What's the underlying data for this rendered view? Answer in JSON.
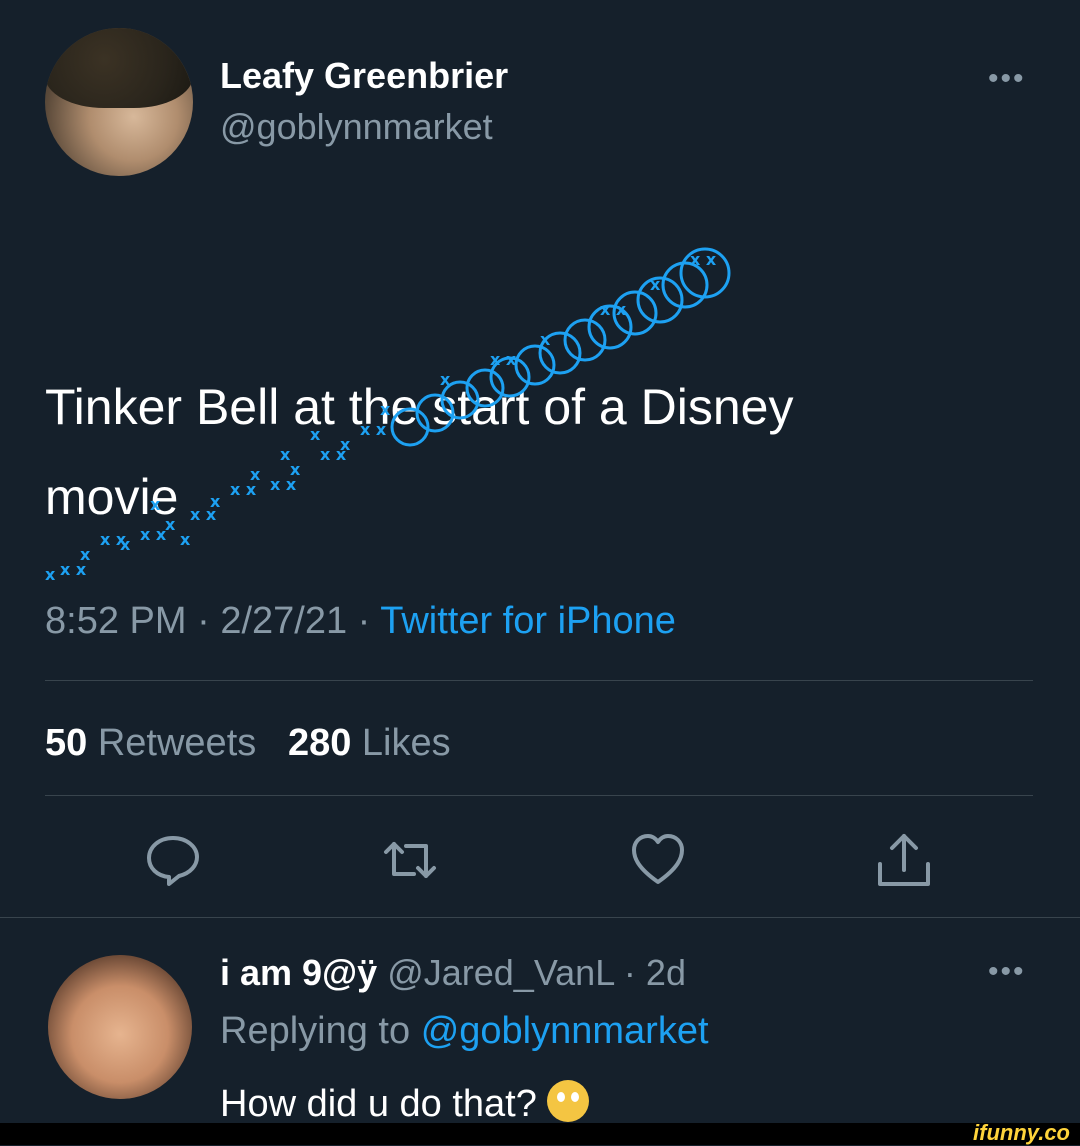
{
  "tweet": {
    "author_name": "Leafy Greenbrier",
    "author_handle": "@goblynnmarket",
    "more_icon": "•••",
    "text_line1": "Tinker Bell at the start of a Disney",
    "text_line2": "movie",
    "time": "8:52 PM",
    "date": "2/27/21",
    "separator": "·",
    "source": "Twitter for iPhone",
    "retweets_count": "50",
    "retweets_label": "Retweets",
    "likes_count": "280",
    "likes_label": "Likes"
  },
  "actions": {
    "icons": [
      "reply-icon",
      "retweet-icon",
      "like-icon",
      "share-icon"
    ]
  },
  "reply": {
    "name": "i am 9@ÿ",
    "handle": "@Jared_VanL",
    "age": "2d",
    "replying_prefix": "Replying to",
    "replying_to": "@goblynnmarket",
    "text": "How did u do that?",
    "more_icon": "•••"
  },
  "watermark": "ifunny.co",
  "colors": {
    "background": "#15202b",
    "secondary_text": "#8899a6",
    "accent": "#1da1f2",
    "divider": "#38444d"
  }
}
